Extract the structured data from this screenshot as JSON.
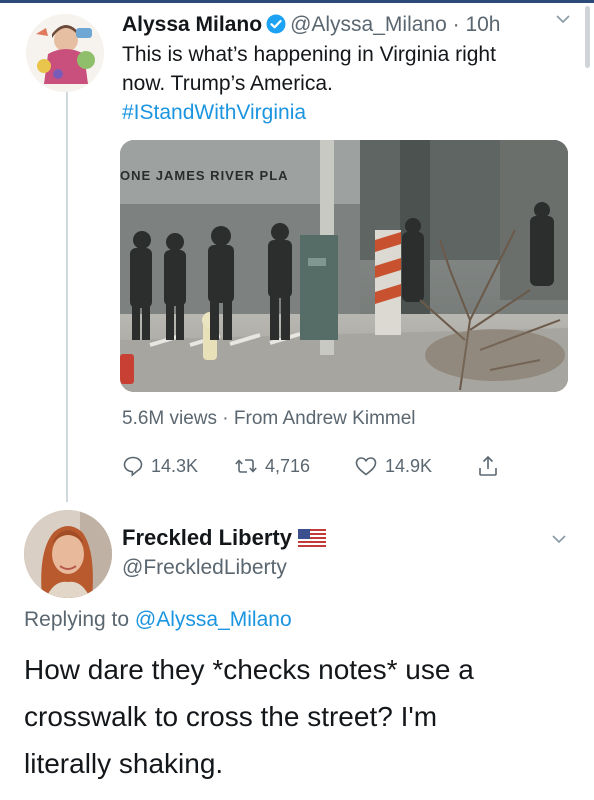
{
  "tweet": {
    "author_name": "Alyssa Milano",
    "handle": "@Alyssa_Milano",
    "separator": " · ",
    "time": "10h",
    "text_lines": [
      "This is what’s happening in Virginia right",
      "now. Trump’s America."
    ],
    "hashtag": "#IStandWithVirginia",
    "media_caption_text": "ONE JAMES RIVER PLA",
    "views": "5.6M views",
    "views_separator": " · ",
    "views_source": "From Andrew Kimmel",
    "stats": {
      "replies": "14.3K",
      "retweets": "4,716",
      "likes": "14.9K"
    },
    "icons": {
      "verified": "verified-badge-icon",
      "more": "chevron-down-icon"
    }
  },
  "reply": {
    "author_name": "Freckled Liberty",
    "handle": "@FreckledLiberty",
    "replying_prefix": "Replying to ",
    "replying_handle": "@Alyssa_Milano",
    "text_lines": [
      "How dare they *checks notes* use a",
      "crosswalk to cross the street? I'm",
      "literally shaking."
    ],
    "icons": {
      "flag": "us-flag-icon",
      "more": "chevron-down-icon"
    }
  },
  "colors": {
    "link": "#1b95e0",
    "muted": "#5b6770",
    "verified": "#1da1f2",
    "text": "#14171a"
  }
}
